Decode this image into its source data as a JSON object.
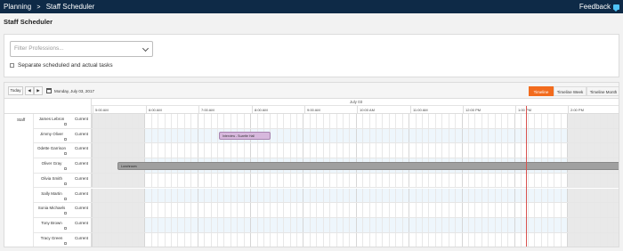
{
  "topbar": {
    "breadcrumb": [
      "Planning",
      "Staff Scheduler"
    ],
    "separator": ">",
    "feedback_label": "Feedback",
    "feedback_icon": "feedback-icon"
  },
  "page": {
    "title": "Staff Scheduler"
  },
  "filters": {
    "professions_placeholder": "Filter Professions...",
    "separate_label": "Separate scheduled and actual tasks",
    "separate_checked": false
  },
  "toolbar": {
    "today_label": "Today",
    "prev_icon": "chevron-left-icon",
    "next_icon": "chevron-right-icon",
    "calendar_icon": "calendar-icon",
    "date_label": "Monday, July 03, 2017",
    "views": [
      "Timeline",
      "Timeline Week",
      "Timeline Month"
    ],
    "active_view": "Timeline"
  },
  "grid": {
    "day_label": "July 03",
    "staff_group_label": "Staff",
    "hours": [
      "5:00 AM",
      "6:00 AM",
      "7:00 AM",
      "8:00 AM",
      "9:00 AM",
      "10:00 AM",
      "11:00 AM",
      "12:00 PM",
      "1:00 PM",
      "2:00 PM"
    ],
    "staff": [
      {
        "name": "James Lebron",
        "status": "Current"
      },
      {
        "name": "Jimmy Oliver",
        "status": "Current"
      },
      {
        "name": "Odette Garrison",
        "status": "Current"
      },
      {
        "name": "Oliver Gray",
        "status": "Current"
      },
      {
        "name": "Olivia Smith",
        "status": "Current"
      },
      {
        "name": "Sally Martin",
        "status": "Current"
      },
      {
        "name": "Sonia Michaels",
        "status": "Current"
      },
      {
        "name": "Tony Brown",
        "status": "Current"
      },
      {
        "name": "Tracy Green",
        "status": "Current"
      }
    ],
    "events": [
      {
        "label": "Interview - Suzette Hall",
        "staff_index": 1,
        "type": "interview"
      },
      {
        "label": "Lunchroom",
        "staff_index": 3,
        "type": "lunch"
      }
    ]
  }
}
